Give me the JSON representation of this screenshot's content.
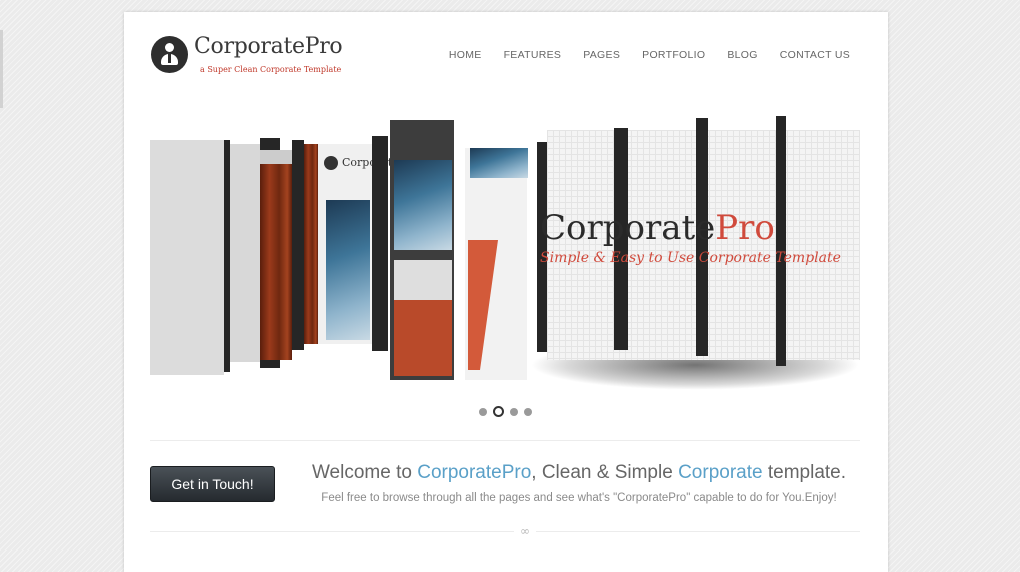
{
  "header": {
    "brand": "CorporatePro",
    "tagline": "a Super Clean Corporate Template",
    "nav": [
      "HOME",
      "FEATURES",
      "PAGES",
      "PORTFOLIO",
      "BLOG",
      "CONTACT US"
    ]
  },
  "slider": {
    "heading_dark": "Corporate",
    "heading_accent": "Pro",
    "subheading": "Simple & Easy to Use Corporate Template",
    "mini_brand": "CorporatePro",
    "dots_count": 4,
    "active_dot": 2
  },
  "intro": {
    "cta_label": "Get in Touch!",
    "welcome_1": "Welcome to ",
    "welcome_hl_1": "CorporatePro",
    "welcome_2": ", Clean & Simple ",
    "welcome_hl_2": "Corporate",
    "welcome_3": " template.",
    "subtitle": "Feel free to browse through all the pages and see what's \"CorporatePro\" capable to do for You.Enjoy!"
  },
  "colors": {
    "accent_red": "#c0392b",
    "accent_blue": "#5aa0c8",
    "button_dark": "#2b3035"
  }
}
